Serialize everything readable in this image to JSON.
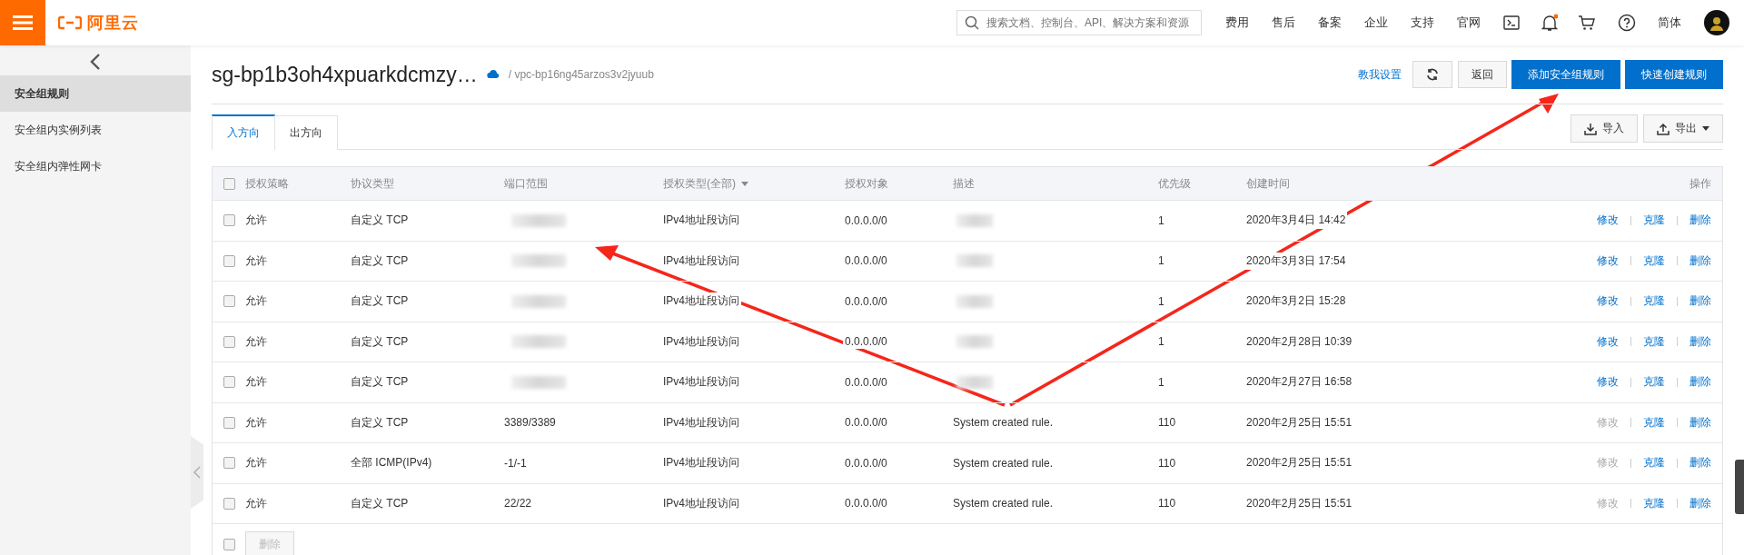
{
  "topbar": {
    "logo_text": "阿里云",
    "search": {
      "placeholder": "搜索文档、控制台、API、解决方案和资源"
    },
    "nav_links": [
      "费用",
      "售后",
      "备案",
      "企业",
      "支持",
      "官网"
    ],
    "notification_dot": true,
    "language": "简体"
  },
  "sidebar": {
    "items": [
      {
        "label": "安全组规则",
        "selected": true
      },
      {
        "label": "安全组内实例列表",
        "selected": false
      },
      {
        "label": "安全组内弹性网卡",
        "selected": false
      }
    ]
  },
  "header": {
    "title": "sg-bp1b3oh4xpuarkdcmzy…",
    "vpc": "/ vpc-bp16ng45arzos3v2jyuub",
    "help_link": "教我设置",
    "back_button": "返回",
    "primary_buttons": [
      "添加安全组规则",
      "快速创建规则"
    ]
  },
  "tabs": [
    {
      "label": "入方向",
      "selected": true
    },
    {
      "label": "出方向",
      "selected": false
    }
  ],
  "toolbar": {
    "import": "导入",
    "export": "导出"
  },
  "table": {
    "header_checked": false,
    "columns": [
      "授权策略",
      "协议类型",
      "端口范围",
      "授权类型(全部)",
      "授权对象",
      "描述",
      "优先级",
      "创建时间",
      "操作"
    ],
    "rows": [
      {
        "checked": false,
        "policy": "允许",
        "protocol": "自定义 TCP",
        "redacted": true,
        "auth_type": "IPv4地址段访问",
        "target": "0.0.0.0/0",
        "priority": "1",
        "created": "2020年3月4日 14:42",
        "actions": [
          {
            "label": "修改",
            "disabled": false
          },
          {
            "label": "克隆",
            "disabled": false
          },
          {
            "label": "删除",
            "disabled": false
          }
        ]
      },
      {
        "checked": false,
        "policy": "允许",
        "protocol": "自定义 TCP",
        "redacted": true,
        "auth_type": "IPv4地址段访问",
        "target": "0.0.0.0/0",
        "priority": "1",
        "created": "2020年3月3日 17:54",
        "actions": [
          {
            "label": "修改",
            "disabled": false
          },
          {
            "label": "克隆",
            "disabled": false
          },
          {
            "label": "删除",
            "disabled": false
          }
        ]
      },
      {
        "checked": false,
        "policy": "允许",
        "protocol": "自定义 TCP",
        "redacted": true,
        "auth_type": "IPv4地址段访问",
        "target": "0.0.0.0/0",
        "priority": "1",
        "created": "2020年3月2日 15:28",
        "actions": [
          {
            "label": "修改",
            "disabled": false
          },
          {
            "label": "克隆",
            "disabled": false
          },
          {
            "label": "删除",
            "disabled": false
          }
        ]
      },
      {
        "checked": false,
        "policy": "允许",
        "protocol": "自定义 TCP",
        "redacted": true,
        "auth_type": "IPv4地址段访问",
        "target": "0.0.0.0/0",
        "priority": "1",
        "created": "2020年2月28日 10:39",
        "actions": [
          {
            "label": "修改",
            "disabled": false
          },
          {
            "label": "克隆",
            "disabled": false
          },
          {
            "label": "删除",
            "disabled": false
          }
        ]
      },
      {
        "checked": false,
        "policy": "允许",
        "protocol": "自定义 TCP",
        "redacted": true,
        "auth_type": "IPv4地址段访问",
        "target": "0.0.0.0/0",
        "priority": "1",
        "created": "2020年2月27日 16:58",
        "actions": [
          {
            "label": "修改",
            "disabled": false
          },
          {
            "label": "克隆",
            "disabled": false
          },
          {
            "label": "删除",
            "disabled": false
          }
        ]
      },
      {
        "checked": false,
        "policy": "允许",
        "protocol": "自定义 TCP",
        "port": "3389/3389",
        "redacted": false,
        "auth_type": "IPv4地址段访问",
        "target": "0.0.0.0/0",
        "description": "System created rule.",
        "priority": "110",
        "created": "2020年2月25日 15:51",
        "actions": [
          {
            "label": "修改",
            "disabled": true
          },
          {
            "label": "克隆",
            "disabled": false
          },
          {
            "label": "删除",
            "disabled": false
          }
        ]
      },
      {
        "checked": false,
        "policy": "允许",
        "protocol": "全部 ICMP(IPv4)",
        "port": "-1/-1",
        "redacted": false,
        "auth_type": "IPv4地址段访问",
        "target": "0.0.0.0/0",
        "description": "System created rule.",
        "priority": "110",
        "created": "2020年2月25日 15:51",
        "actions": [
          {
            "label": "修改",
            "disabled": true
          },
          {
            "label": "克隆",
            "disabled": false
          },
          {
            "label": "删除",
            "disabled": false
          }
        ]
      },
      {
        "checked": false,
        "policy": "允许",
        "protocol": "自定义 TCP",
        "port": "22/22",
        "redacted": false,
        "auth_type": "IPv4地址段访问",
        "target": "0.0.0.0/0",
        "description": "System created rule.",
        "priority": "110",
        "created": "2020年2月25日 15:51",
        "actions": [
          {
            "label": "修改",
            "disabled": true
          },
          {
            "label": "克隆",
            "disabled": false
          },
          {
            "label": "删除",
            "disabled": false
          }
        ]
      }
    ],
    "footer": {
      "select_all_checked": false,
      "delete_button": "删除"
    }
  }
}
